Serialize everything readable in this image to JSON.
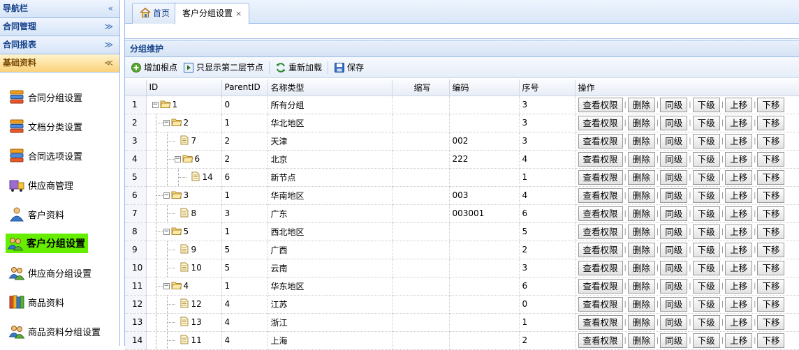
{
  "sidebar": {
    "sections": [
      {
        "title": "导航栏",
        "tool": "«"
      },
      {
        "title": "合同管理",
        "tool": "≫"
      },
      {
        "title": "合同报表",
        "tool": "≫"
      },
      {
        "title": "基础资料",
        "tool": "≪"
      }
    ],
    "items": [
      {
        "label": "合同分组设置",
        "icon": "stack-icon"
      },
      {
        "label": "文档分类设置",
        "icon": "stack-icon"
      },
      {
        "label": "合同选项设置",
        "icon": "stack-icon"
      },
      {
        "label": "供应商管理",
        "icon": "supplier-icon"
      },
      {
        "label": "客户资料",
        "icon": "customer-icon"
      },
      {
        "label": "客户分组设置",
        "icon": "users-icon"
      },
      {
        "label": "供应商分组设置",
        "icon": "users-icon"
      },
      {
        "label": "商品资料",
        "icon": "books-icon"
      },
      {
        "label": "商品资料分组设置",
        "icon": "users-icon"
      }
    ]
  },
  "tabs": [
    {
      "label": "首页",
      "icon": "home-icon"
    },
    {
      "label": "客户分组设置",
      "close": "×"
    }
  ],
  "panel": {
    "title": "分组维护",
    "toolbar": {
      "add_root": "增加根点",
      "show_second": "只显示第二层节点",
      "reload": "重新加载",
      "save": "保存"
    }
  },
  "grid": {
    "columns": {
      "id": "ID",
      "parent": "ParentID",
      "name": "名称类型",
      "abbr": "缩写",
      "code": "编码",
      "order": "序号",
      "ops": "操作"
    },
    "ops": [
      "查看权限",
      "删除",
      "同级",
      "下级",
      "上移",
      "下移"
    ],
    "rows": [
      {
        "rn": "1",
        "id": "1",
        "parent": "0",
        "name": "所有分组",
        "abbr": "",
        "code": "",
        "order": "3"
      },
      {
        "rn": "2",
        "id": "2",
        "parent": "1",
        "name": "华北地区",
        "abbr": "",
        "code": "",
        "order": "3"
      },
      {
        "rn": "3",
        "id": "7",
        "parent": "2",
        "name": "天津",
        "abbr": "",
        "code": "002",
        "order": "3"
      },
      {
        "rn": "4",
        "id": "6",
        "parent": "2",
        "name": "北京",
        "abbr": "",
        "code": "222",
        "order": "4"
      },
      {
        "rn": "5",
        "id": "14",
        "parent": "6",
        "name": "新节点",
        "abbr": "",
        "code": "",
        "order": "1"
      },
      {
        "rn": "6",
        "id": "3",
        "parent": "1",
        "name": "华南地区",
        "abbr": "",
        "code": "003",
        "order": "4"
      },
      {
        "rn": "7",
        "id": "8",
        "parent": "3",
        "name": "广东",
        "abbr": "",
        "code": "003001",
        "order": "6"
      },
      {
        "rn": "8",
        "id": "5",
        "parent": "1",
        "name": "西北地区",
        "abbr": "",
        "code": "",
        "order": "5"
      },
      {
        "rn": "9",
        "id": "9",
        "parent": "5",
        "name": "广西",
        "abbr": "",
        "code": "",
        "order": "2"
      },
      {
        "rn": "10",
        "id": "10",
        "parent": "5",
        "name": "云南",
        "abbr": "",
        "code": "",
        "order": "3"
      },
      {
        "rn": "11",
        "id": "4",
        "parent": "1",
        "name": "华东地区",
        "abbr": "",
        "code": "",
        "order": "6"
      },
      {
        "rn": "12",
        "id": "12",
        "parent": "4",
        "name": "江苏",
        "abbr": "",
        "code": "",
        "order": "0"
      },
      {
        "rn": "13",
        "id": "13",
        "parent": "4",
        "name": "浙江",
        "abbr": "",
        "code": "",
        "order": "1"
      },
      {
        "rn": "14",
        "id": "11",
        "parent": "4",
        "name": "上海",
        "abbr": "",
        "code": "",
        "order": "2"
      }
    ]
  }
}
